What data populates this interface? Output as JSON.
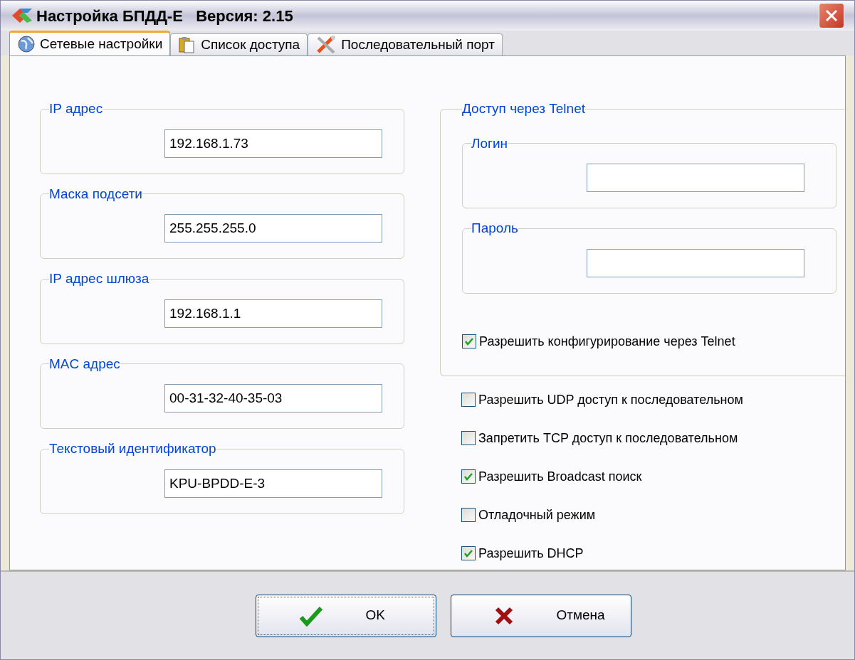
{
  "window": {
    "title": "Настройка БПДД-Е   Версия: 2.15"
  },
  "tabs": [
    {
      "label": "Сетевые настройки",
      "kind": "network",
      "selected": true
    },
    {
      "label": "Список доступа",
      "kind": "access",
      "selected": false
    },
    {
      "label": "Последовательный порт",
      "kind": "serial",
      "selected": false
    }
  ],
  "network_fields": [
    {
      "label": "IP адрес",
      "value": "192.168.1.73"
    },
    {
      "label": "Маска подсети",
      "value": "255.255.255.0"
    },
    {
      "label": "IP адрес шлюза",
      "value": "192.168.1.1"
    },
    {
      "label": "MAC адрес",
      "value": "00-31-32-40-35-03"
    },
    {
      "label": "Текстовый идентификатор",
      "value": "KPU-BPDD-E-3"
    }
  ],
  "telnet": {
    "title": "Доступ через Telnet",
    "fields": [
      {
        "label": "Логин"
      },
      {
        "label": "Пароль"
      }
    ],
    "enable": {
      "label": "Разрешить конфигурирование через Telnet",
      "checked": true
    }
  },
  "options": [
    {
      "label": "Разрешить UDP доступ к последовательном",
      "checked": false
    },
    {
      "label": "Запретить TCP доступ к последовательном",
      "checked": false
    },
    {
      "label": "Разрешить Broadcast поиск",
      "checked": true
    },
    {
      "label": "Отладочный режим",
      "checked": false
    },
    {
      "label": "Разрешить DHCP",
      "checked": true
    }
  ],
  "buttons": [
    {
      "kind": "ok",
      "label": "OK",
      "focused": true
    },
    {
      "kind": "cancel",
      "label": "Отмена",
      "focused": false
    }
  ]
}
